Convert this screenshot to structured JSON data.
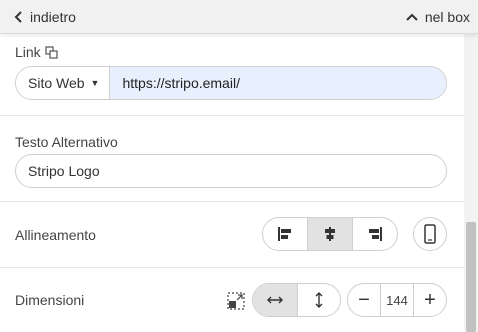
{
  "header": {
    "back_label": "indietro",
    "collapse_label": "nel box"
  },
  "link": {
    "label": "Link",
    "type_selected": "Sito Web",
    "url_value": "https://stripo.email/"
  },
  "alt_text": {
    "label": "Testo Alternativo",
    "value": "Stripo Logo"
  },
  "alignment": {
    "label": "Allineamento",
    "options": [
      "align-left-icon",
      "align-center-icon",
      "align-right-icon"
    ],
    "selected": "center"
  },
  "dimensions": {
    "label": "Dimensioni",
    "value": "144",
    "minus": "−",
    "plus": "+"
  },
  "colors": {
    "active_segment": "#e2e2e2",
    "url_background": "#e8f0fe",
    "topbar": "#f1f1f1"
  }
}
